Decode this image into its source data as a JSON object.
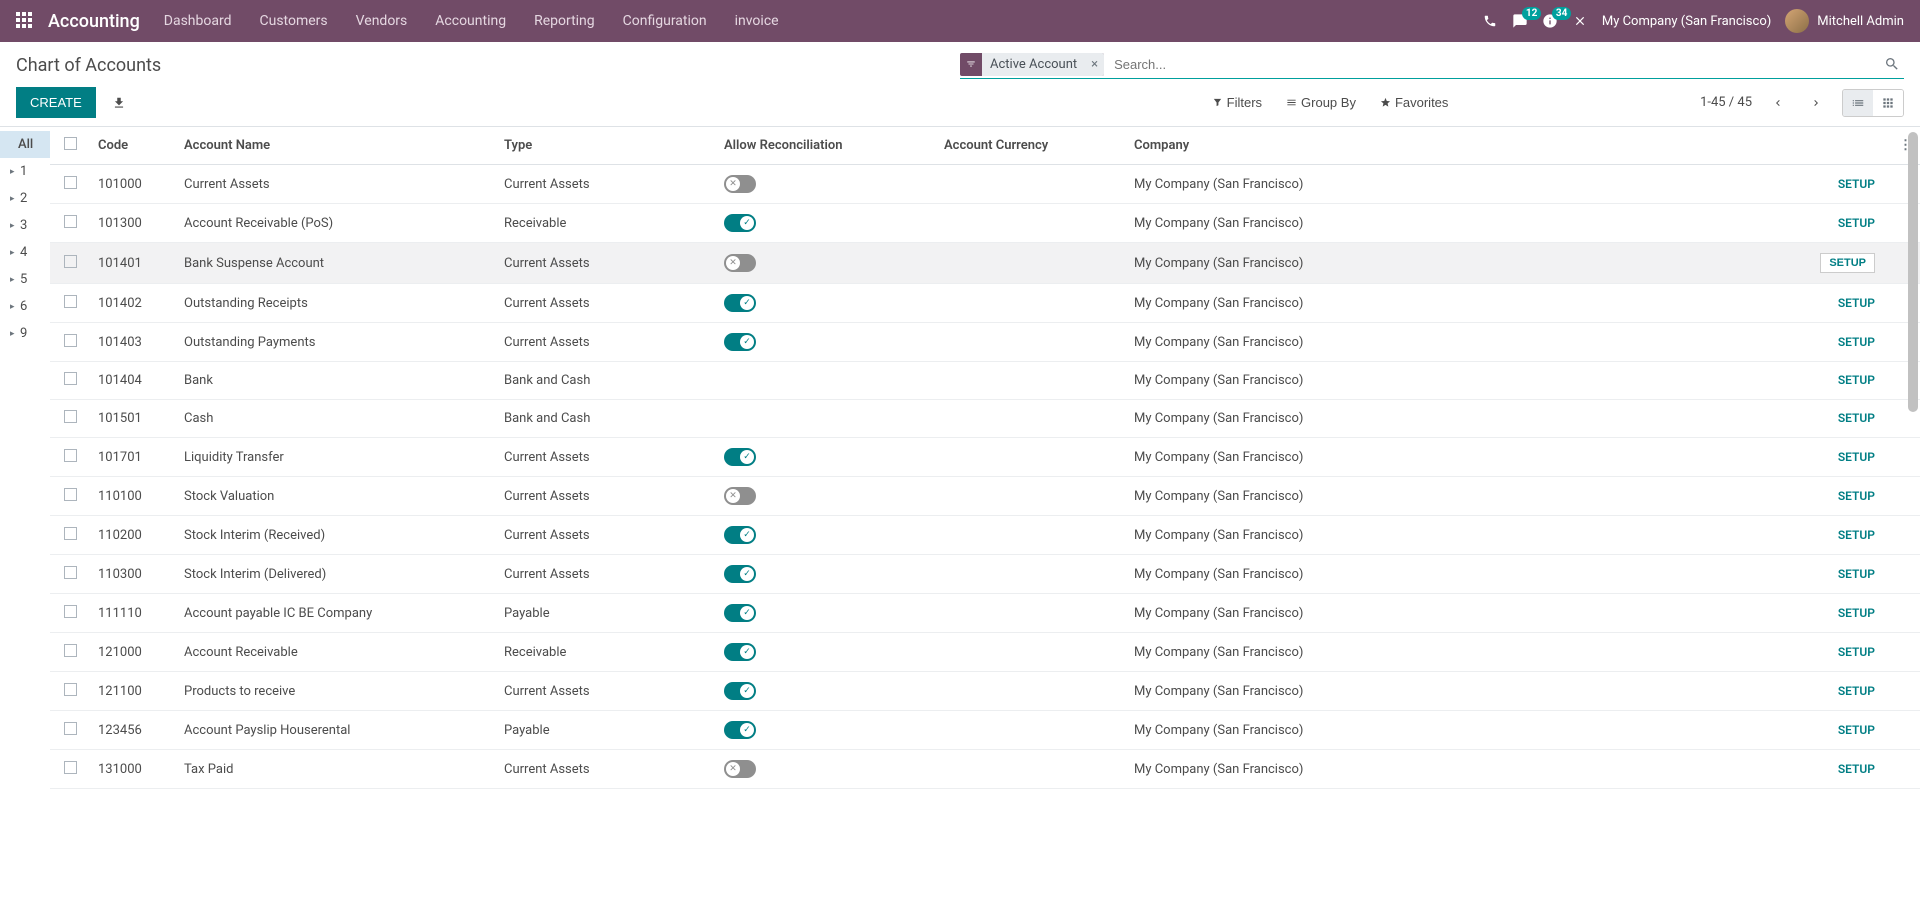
{
  "nav": {
    "brand": "Accounting",
    "menu": [
      "Dashboard",
      "Customers",
      "Vendors",
      "Accounting",
      "Reporting",
      "Configuration",
      "invoice"
    ],
    "msg_count": "12",
    "activity_count": "34",
    "company": "My Company (San Francisco)",
    "user": "Mitchell Admin"
  },
  "page": {
    "title": "Chart of Accounts",
    "create": "CREATE",
    "search_placeholder": "Search...",
    "facet_label": "Active Account",
    "filters": "Filters",
    "groupby": "Group By",
    "favorites": "Favorites",
    "pager": "1-45 / 45"
  },
  "sidebar": [
    "All",
    "1",
    "2",
    "3",
    "4",
    "5",
    "6",
    "9"
  ],
  "columns": {
    "code": "Code",
    "name": "Account Name",
    "type": "Type",
    "recon": "Allow Reconciliation",
    "curr": "Account Currency",
    "company": "Company",
    "setup": "SETUP"
  },
  "rows": [
    {
      "code": "101000",
      "name": "Current Assets",
      "type": "Current Assets",
      "recon": "off",
      "company": "My Company (San Francisco)"
    },
    {
      "code": "101300",
      "name": "Account Receivable (PoS)",
      "type": "Receivable",
      "recon": "on",
      "company": "My Company (San Francisco)"
    },
    {
      "code": "101401",
      "name": "Bank Suspense Account",
      "type": "Current Assets",
      "recon": "off",
      "company": "My Company (San Francisco)",
      "hover": true
    },
    {
      "code": "101402",
      "name": "Outstanding Receipts",
      "type": "Current Assets",
      "recon": "on",
      "company": "My Company (San Francisco)"
    },
    {
      "code": "101403",
      "name": "Outstanding Payments",
      "type": "Current Assets",
      "recon": "on",
      "company": "My Company (San Francisco)"
    },
    {
      "code": "101404",
      "name": "Bank",
      "type": "Bank and Cash",
      "recon": "",
      "company": "My Company (San Francisco)"
    },
    {
      "code": "101501",
      "name": "Cash",
      "type": "Bank and Cash",
      "recon": "",
      "company": "My Company (San Francisco)"
    },
    {
      "code": "101701",
      "name": "Liquidity Transfer",
      "type": "Current Assets",
      "recon": "on",
      "company": "My Company (San Francisco)"
    },
    {
      "code": "110100",
      "name": "Stock Valuation",
      "type": "Current Assets",
      "recon": "off",
      "company": "My Company (San Francisco)"
    },
    {
      "code": "110200",
      "name": "Stock Interim (Received)",
      "type": "Current Assets",
      "recon": "on",
      "company": "My Company (San Francisco)"
    },
    {
      "code": "110300",
      "name": "Stock Interim (Delivered)",
      "type": "Current Assets",
      "recon": "on",
      "company": "My Company (San Francisco)"
    },
    {
      "code": "111110",
      "name": "Account payable IC BE Company",
      "type": "Payable",
      "recon": "on",
      "company": "My Company (San Francisco)"
    },
    {
      "code": "121000",
      "name": "Account Receivable",
      "type": "Receivable",
      "recon": "on",
      "company": "My Company (San Francisco)"
    },
    {
      "code": "121100",
      "name": "Products to receive",
      "type": "Current Assets",
      "recon": "on",
      "company": "My Company (San Francisco)"
    },
    {
      "code": "123456",
      "name": "Account Payslip Houserental",
      "type": "Payable",
      "recon": "on",
      "company": "My Company (San Francisco)"
    },
    {
      "code": "131000",
      "name": "Tax Paid",
      "type": "Current Assets",
      "recon": "off",
      "company": "My Company (San Francisco)"
    }
  ]
}
